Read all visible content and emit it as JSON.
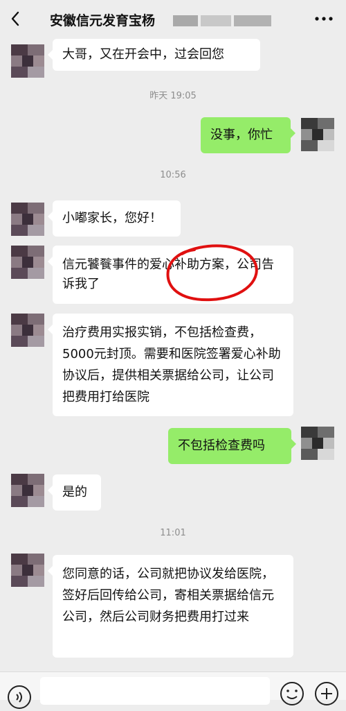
{
  "header": {
    "title": "安徽信元发育宝杨"
  },
  "messages": [
    {
      "text": "大哥，又在开会中，过会回您"
    },
    {
      "time": "昨天 19:05"
    },
    {
      "text": "没事，你忙"
    },
    {
      "time": "10:56"
    },
    {
      "text": "小嘟家长，您好！"
    },
    {
      "text": "信元饕餮事件的爱心补助方案，公司告诉我了"
    },
    {
      "text": "治疗费用实报实销，不包括检查费，5000元封顶。需要和医院签署爱心补助协议后，提供相关票据给公司，让公司把费用打给医院"
    },
    {
      "text": "不包括检查费吗"
    },
    {
      "text": "是的"
    },
    {
      "time": "11:01"
    },
    {
      "text": "您同意的话，公司就把协议发给医院，签好后回传给公司，寄相关票据给信元公司，然后公司财务把费用打过来"
    }
  ],
  "icons": {
    "back": "chevron-left-icon",
    "more": "more-dots-icon",
    "voice": "voice-icon",
    "emoji": "emoji-icon",
    "plus": "plus-circle-icon"
  },
  "colors": {
    "background": "#ededed",
    "incoming_bubble": "#ffffff",
    "outgoing_bubble": "#95ec69",
    "annotation_circle": "#e01010"
  }
}
